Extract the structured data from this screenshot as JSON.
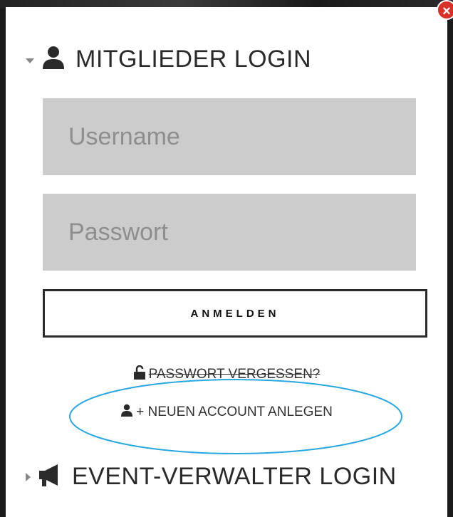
{
  "close": {
    "symbol": "×"
  },
  "member_login": {
    "title": "MITGLIEDER LOGIN",
    "username_placeholder": "Username",
    "password_placeholder": "Passwort",
    "login_button": "ANMELDEN",
    "forgot_password": "PASSWORT VERGESSEN?",
    "new_account": "+ NEUEN ACCOUNT ANLEGEN"
  },
  "event_login": {
    "title": "EVENT-VERWALTER LOGIN"
  },
  "icons": {
    "member": "user-icon",
    "event": "megaphone-icon",
    "forgot": "unlock-icon",
    "new_account": "user-add-icon"
  },
  "colors": {
    "highlight": "#29a8df",
    "input_bg": "#cccccc",
    "close_bg": "#d9302a"
  }
}
